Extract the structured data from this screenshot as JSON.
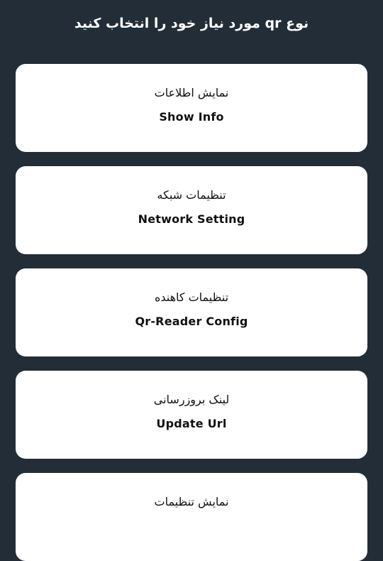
{
  "header": {
    "title": "نوع qr مورد نیاز خود را انتخاب کنید"
  },
  "options": [
    {
      "fa": "نمایش اطلاعات",
      "en": "Show Info"
    },
    {
      "fa": "تنظیمات شبکه",
      "en": "Network Setting"
    },
    {
      "fa": "تنظیمات کاهنده",
      "en": "Qr-Reader Config"
    },
    {
      "fa": "لینک بروزرسانی",
      "en": "Update Url"
    },
    {
      "fa": "نمایش تنظیمات",
      "en": ""
    }
  ]
}
